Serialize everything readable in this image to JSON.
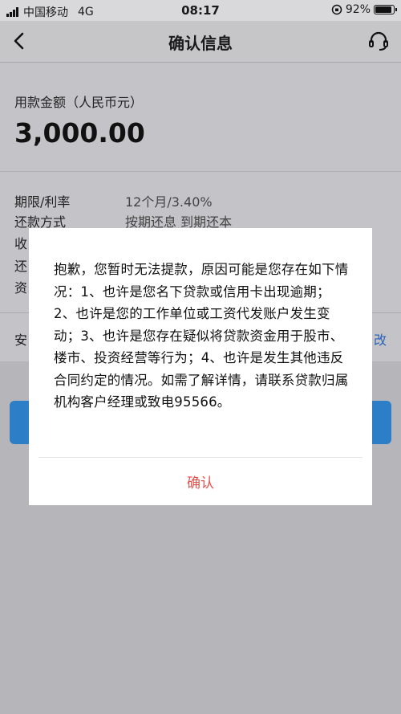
{
  "status_bar": {
    "carrier": "中国移动",
    "network": "4G",
    "time": "08:17",
    "battery": "92%",
    "battery_level": 0.92,
    "icons": [
      "signal-icon",
      "orientation-lock-icon",
      "battery-icon"
    ]
  },
  "nav": {
    "title": "确认信息",
    "back_icon": "chevron-left-icon",
    "service_icon": "headset-icon"
  },
  "amount": {
    "label": "用款金额（人民币元）",
    "value": "3,000.00"
  },
  "details": {
    "rows": [
      {
        "label": "期限/利率",
        "value": "12个月/3.40%"
      },
      {
        "label": "还款方式",
        "value": "按期还息 到期还本"
      },
      {
        "label": "收",
        "value": ""
      },
      {
        "label": "还",
        "value": ""
      },
      {
        "label": "资",
        "value": ""
      }
    ]
  },
  "security": {
    "label": "安",
    "edit": "改"
  },
  "dialog": {
    "message": "抱歉，您暂时无法提款，原因可能是您存在如下情况：1、也许是您名下贷款或信用卡出现逾期；2、也许是您的工作单位或工资代发账户发生变动；3、也许是您存在疑似将贷款资金用于股市、楼市、投资经营等行为；4、也许是发生其他违反合同约定的情况。如需了解详情，请联系贷款归属机构客户经理或致电95566。",
    "button": "确认"
  },
  "colors": {
    "accent": "#2c7fc7",
    "dialog_button": "#e0524c",
    "link": "#2a62b7"
  }
}
